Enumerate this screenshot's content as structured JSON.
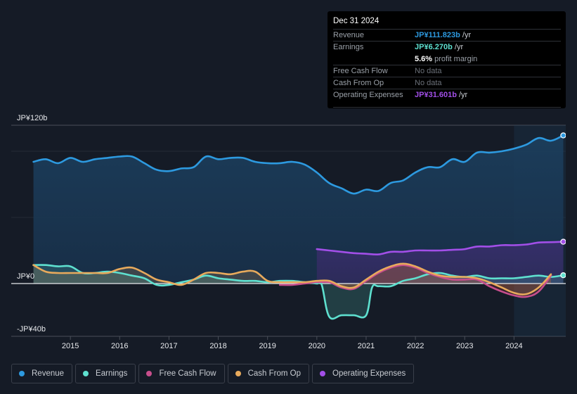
{
  "tooltip": {
    "date": "Dec 31 2024",
    "rows": [
      {
        "label": "Revenue",
        "value": "JP¥111.823b",
        "unit": "/yr",
        "color": "#2d9ae0"
      },
      {
        "label": "Earnings",
        "value": "JP¥6.270b",
        "unit": "/yr",
        "color": "#5ee0cf"
      },
      {
        "label": "Free Cash Flow",
        "value": "No data"
      },
      {
        "label": "Cash From Op",
        "value": "No data"
      },
      {
        "label": "Operating Expenses",
        "value": "JP¥31.601b",
        "unit": "/yr",
        "color": "#a24fe8"
      }
    ],
    "profit_margin_value": "5.6%",
    "profit_margin_label": "profit margin"
  },
  "legend": [
    {
      "label": "Revenue",
      "color": "#2d9ae0"
    },
    {
      "label": "Earnings",
      "color": "#5ee0cf"
    },
    {
      "label": "Free Cash Flow",
      "color": "#c74e8c"
    },
    {
      "label": "Cash From Op",
      "color": "#e8aa5c"
    },
    {
      "label": "Operating Expenses",
      "color": "#a24fe8"
    }
  ],
  "chart_data": {
    "type": "area",
    "title": "",
    "xlabel": "",
    "ylabel": "",
    "ylim": [
      -40,
      120
    ],
    "y_tick_labels": [
      {
        "value": 120,
        "label": "JP¥120b"
      },
      {
        "value": 0,
        "label": "JP¥0"
      },
      {
        "value": -40,
        "label": "-JP¥40b"
      }
    ],
    "x_tick_labels": [
      "2015",
      "2016",
      "2017",
      "2018",
      "2019",
      "2020",
      "2021",
      "2022",
      "2023",
      "2024"
    ],
    "x_tick_values": [
      2015,
      2016,
      2017,
      2018,
      2019,
      2020,
      2021,
      2022,
      2023,
      2024
    ],
    "xlim": [
      2013.8,
      2025.05
    ],
    "forecast_shade_start": 2024.0,
    "grid": true,
    "legend_position": "bottom",
    "series": [
      {
        "name": "Revenue",
        "color": "#2d9ae0",
        "x": [
          2014.25,
          2014.5,
          2014.75,
          2015.0,
          2015.25,
          2015.5,
          2015.75,
          2016.0,
          2016.25,
          2016.5,
          2016.75,
          2017.0,
          2017.25,
          2017.5,
          2017.75,
          2018.0,
          2018.25,
          2018.5,
          2018.75,
          2019.0,
          2019.25,
          2019.5,
          2019.75,
          2020.0,
          2020.25,
          2020.5,
          2020.75,
          2021.0,
          2021.25,
          2021.5,
          2021.75,
          2022.0,
          2022.25,
          2022.5,
          2022.75,
          2023.0,
          2023.25,
          2023.5,
          2023.75,
          2024.0,
          2024.25,
          2024.5,
          2024.75,
          2025.0
        ],
        "values": [
          92,
          94,
          91,
          95,
          92,
          94,
          95,
          96,
          96,
          91,
          86,
          85,
          87,
          88,
          96,
          94,
          95,
          95,
          92,
          91,
          91,
          92,
          90,
          84,
          76,
          72,
          68,
          71,
          70,
          76,
          78,
          84,
          88,
          88,
          94,
          92,
          99,
          99,
          100,
          102,
          105,
          110,
          108,
          112
        ]
      },
      {
        "name": "Earnings",
        "color": "#5ee0cf",
        "x": [
          2014.25,
          2014.5,
          2014.75,
          2015.0,
          2015.25,
          2015.5,
          2015.75,
          2016.0,
          2016.25,
          2016.5,
          2016.75,
          2017.0,
          2017.25,
          2017.5,
          2017.75,
          2018.0,
          2018.25,
          2018.5,
          2018.75,
          2019.0,
          2019.25,
          2019.5,
          2019.75,
          2020.0,
          2020.1,
          2020.25,
          2020.5,
          2020.75,
          2021.0,
          2021.12,
          2021.25,
          2021.5,
          2021.75,
          2022.0,
          2022.25,
          2022.5,
          2022.75,
          2023.0,
          2023.25,
          2023.5,
          2023.75,
          2024.0,
          2024.25,
          2024.5,
          2024.75,
          2025.0
        ],
        "values": [
          14,
          14,
          13,
          13,
          8,
          8,
          9,
          8,
          6,
          4,
          -1,
          -1,
          1,
          3,
          6,
          4,
          3,
          2,
          2,
          1,
          2,
          2,
          1,
          0,
          -1,
          -25,
          -24,
          -24,
          -24,
          -3,
          -2,
          -2,
          2,
          4,
          7,
          8,
          6,
          5,
          6,
          4,
          4,
          4,
          5,
          6,
          5,
          6.27
        ]
      },
      {
        "name": "Free Cash Flow",
        "color": "#c74e8c",
        "x": [
          2019.25,
          2019.5,
          2019.75,
          2020.0,
          2020.25,
          2020.5,
          2020.75,
          2021.0,
          2021.25,
          2021.5,
          2021.75,
          2022.0,
          2022.25,
          2022.5,
          2022.75,
          2023.0,
          2023.25,
          2023.5,
          2023.75,
          2024.0,
          2024.25,
          2024.5,
          2024.75
        ],
        "values": [
          -1,
          -1,
          0,
          1,
          1,
          -3,
          -4,
          2,
          8,
          12,
          14,
          12,
          8,
          5,
          3,
          3,
          3,
          -2,
          -6,
          -9,
          -10,
          -6,
          6
        ]
      },
      {
        "name": "Cash From Op",
        "color": "#e8aa5c",
        "x": [
          2014.25,
          2014.5,
          2014.75,
          2015.0,
          2015.25,
          2015.5,
          2015.75,
          2016.0,
          2016.25,
          2016.5,
          2016.75,
          2017.0,
          2017.25,
          2017.5,
          2017.75,
          2018.0,
          2018.25,
          2018.5,
          2018.75,
          2019.0,
          2019.25,
          2019.5,
          2019.75,
          2020.0,
          2020.25,
          2020.5,
          2020.75,
          2021.0,
          2021.25,
          2021.5,
          2021.75,
          2022.0,
          2022.25,
          2022.5,
          2022.75,
          2023.0,
          2023.25,
          2023.5,
          2023.75,
          2024.0,
          2024.25,
          2024.5,
          2024.75
        ],
        "values": [
          14,
          9,
          8,
          8,
          8,
          8,
          8,
          11,
          12,
          8,
          3,
          1,
          -1,
          3,
          8,
          8,
          7,
          9,
          9,
          2,
          1,
          1,
          1,
          2,
          2,
          -2,
          -3,
          3,
          9,
          13,
          15,
          13,
          9,
          6,
          5,
          5,
          4,
          1,
          -3,
          -7,
          -8,
          -3,
          7
        ]
      },
      {
        "name": "Operating Expenses",
        "color": "#a24fe8",
        "x": [
          2020.0,
          2020.25,
          2020.5,
          2020.75,
          2021.0,
          2021.25,
          2021.5,
          2021.75,
          2022.0,
          2022.25,
          2022.5,
          2022.75,
          2023.0,
          2023.25,
          2023.5,
          2023.75,
          2024.0,
          2024.25,
          2024.5,
          2024.75,
          2025.0
        ],
        "values": [
          26,
          25,
          24,
          23,
          22.5,
          22,
          24,
          24,
          25,
          25,
          25,
          25.5,
          26,
          28,
          28,
          29,
          29,
          29.5,
          31,
          31.3,
          31.6
        ]
      }
    ]
  }
}
